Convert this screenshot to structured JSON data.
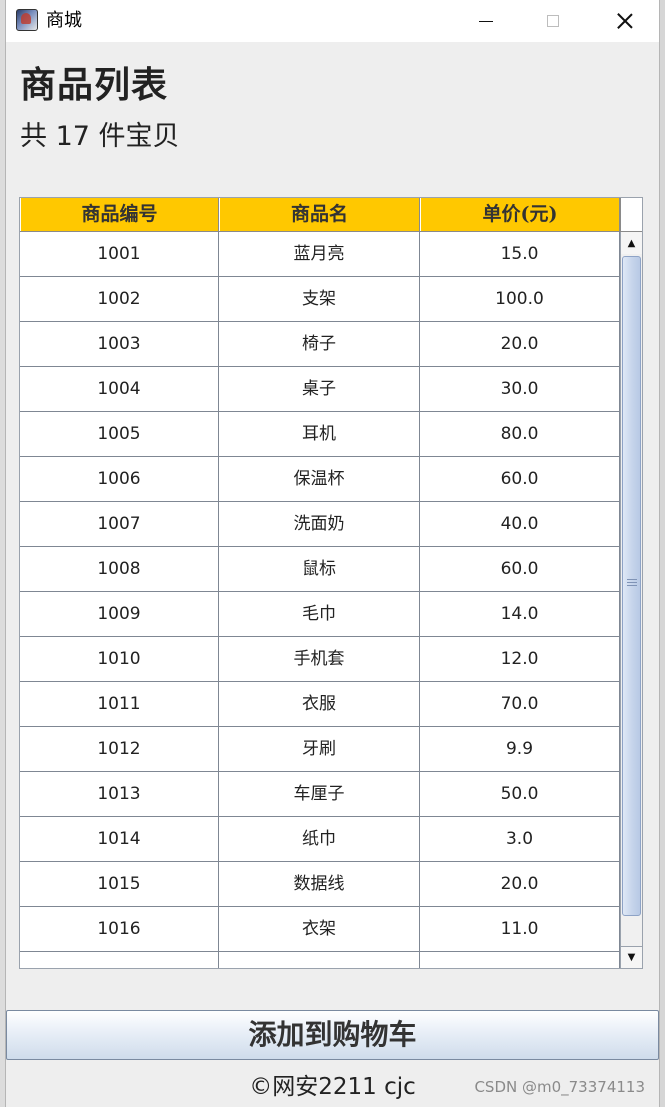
{
  "window": {
    "title": "商城",
    "app_icon": "java-app-icon"
  },
  "header": {
    "title": "商品列表",
    "count_text": "共 17 件宝贝"
  },
  "table": {
    "columns": [
      "商品编号",
      "商品名",
      "单价(元)"
    ],
    "rows": [
      {
        "id": "1001",
        "name": "蓝月亮",
        "price": "15.0"
      },
      {
        "id": "1002",
        "name": "支架",
        "price": "100.0"
      },
      {
        "id": "1003",
        "name": "椅子",
        "price": "20.0"
      },
      {
        "id": "1004",
        "name": "桌子",
        "price": "30.0"
      },
      {
        "id": "1005",
        "name": "耳机",
        "price": "80.0"
      },
      {
        "id": "1006",
        "name": "保温杯",
        "price": "60.0"
      },
      {
        "id": "1007",
        "name": "洗面奶",
        "price": "40.0"
      },
      {
        "id": "1008",
        "name": "鼠标",
        "price": "60.0"
      },
      {
        "id": "1009",
        "name": "毛巾",
        "price": "14.0"
      },
      {
        "id": "1010",
        "name": "手机套",
        "price": "12.0"
      },
      {
        "id": "1011",
        "name": "衣服",
        "price": "70.0"
      },
      {
        "id": "1012",
        "name": "牙刷",
        "price": "9.9"
      },
      {
        "id": "1013",
        "name": "车厘子",
        "price": "50.0"
      },
      {
        "id": "1014",
        "name": "纸巾",
        "price": "3.0"
      },
      {
        "id": "1015",
        "name": "数据线",
        "price": "20.0"
      },
      {
        "id": "1016",
        "name": "衣架",
        "price": "11.0"
      }
    ],
    "header_color": "#ffc800"
  },
  "actions": {
    "add_to_cart_label": "添加到购物车"
  },
  "footer": {
    "text": "©网安2211 cjc"
  },
  "watermark": "CSDN @m0_73374113"
}
